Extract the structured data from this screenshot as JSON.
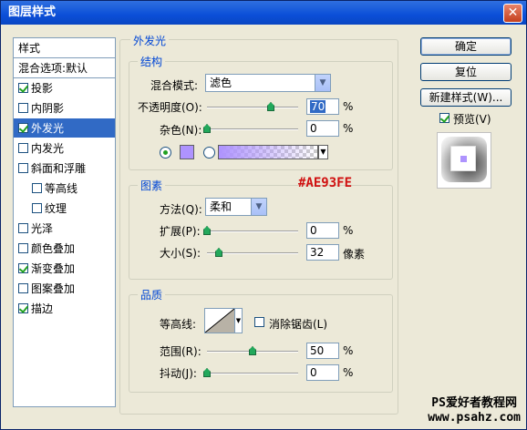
{
  "window": {
    "title": "图层样式",
    "close_label": "✕"
  },
  "left_list": {
    "items": [
      {
        "label": "样式",
        "checkbox": false,
        "checked": false,
        "header": true
      },
      {
        "label": "混合选项:默认",
        "checkbox": false,
        "checked": false,
        "header": true
      },
      {
        "label": "投影",
        "checkbox": true,
        "checked": true
      },
      {
        "label": "内阴影",
        "checkbox": true,
        "checked": false
      },
      {
        "label": "外发光",
        "checkbox": true,
        "checked": true,
        "selected": true
      },
      {
        "label": "内发光",
        "checkbox": true,
        "checked": false
      },
      {
        "label": "斜面和浮雕",
        "checkbox": true,
        "checked": false
      },
      {
        "label": "等高线",
        "checkbox": true,
        "checked": false,
        "indent": true
      },
      {
        "label": "纹理",
        "checkbox": true,
        "checked": false,
        "indent": true
      },
      {
        "label": "光泽",
        "checkbox": true,
        "checked": false
      },
      {
        "label": "颜色叠加",
        "checkbox": true,
        "checked": false
      },
      {
        "label": "渐变叠加",
        "checkbox": true,
        "checked": true
      },
      {
        "label": "图案叠加",
        "checkbox": true,
        "checked": false
      },
      {
        "label": "描边",
        "checkbox": true,
        "checked": true
      }
    ]
  },
  "outer_glow": {
    "title": "外发光",
    "structure": {
      "title": "结构",
      "blend_mode_label": "混合模式:",
      "blend_mode_value": "滤色",
      "opacity_label": "不透明度(O):",
      "opacity_value": "70",
      "opacity_level": 0.7,
      "noise_label": "杂色(N):",
      "noise_value": "0",
      "noise_level": 0,
      "percent": "%"
    },
    "color": "#AE93FE",
    "color_annotation": "#AE93FE",
    "elements": {
      "title": "图素",
      "method_label": "方法(Q):",
      "method_value": "柔和",
      "spread_label": "扩展(P):",
      "spread_value": "0",
      "spread_level": 0,
      "size_label": "大小(S):",
      "size_value": "32",
      "size_level": 0.13,
      "pixel_unit": "像素",
      "percent": "%"
    },
    "quality": {
      "title": "品质",
      "contour_label": "等高线:",
      "anti_alias_label": "消除锯齿(L)",
      "anti_alias_checked": false,
      "range_label": "范围(R):",
      "range_value": "50",
      "range_level": 0.5,
      "jitter_label": "抖动(J):",
      "jitter_value": "0",
      "jitter_level": 0,
      "percent": "%"
    }
  },
  "buttons": {
    "ok": "确定",
    "reset": "复位",
    "new_style": "新建样式(W)...",
    "preview_label": "预览(V)",
    "preview_checked": true
  },
  "watermark": {
    "line1": "PS爱好者教程网",
    "line2": "www.psahz.com"
  }
}
